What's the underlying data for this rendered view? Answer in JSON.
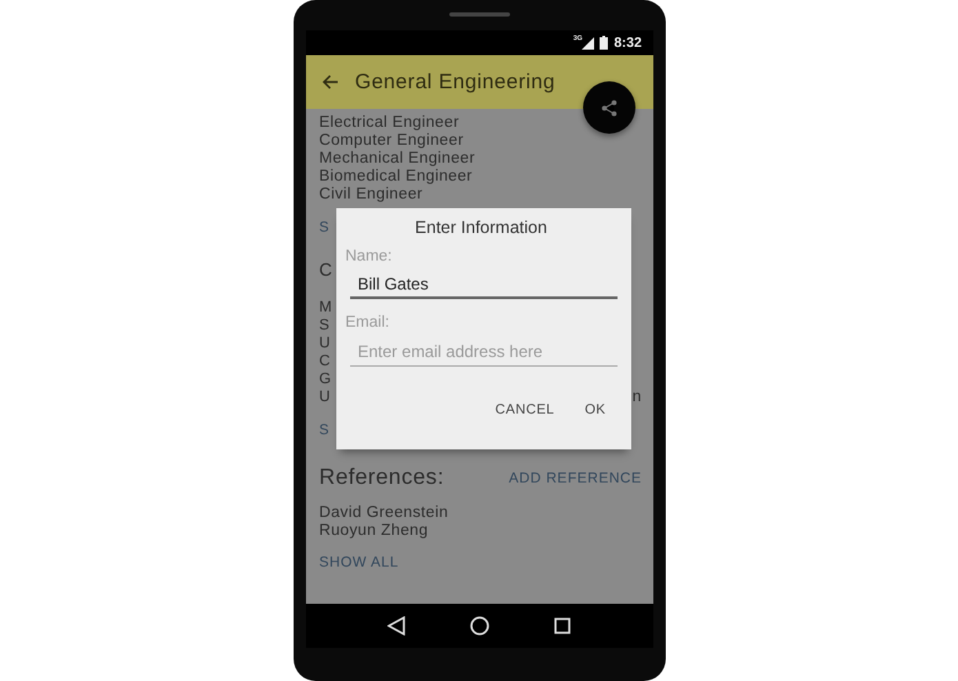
{
  "status_bar": {
    "network": "3G",
    "time": "8:32"
  },
  "app_bar": {
    "title": "General Engineering"
  },
  "content": {
    "specialties": [
      "Electrical Engineer",
      "Computer Engineer",
      "Mechanical Engineer",
      "Biomedical Engineer",
      "Civil Engineer"
    ],
    "specialties_link": "S",
    "section_heading": "C",
    "section_items": [
      "M",
      "S",
      "U",
      "C",
      "G",
      "U"
    ],
    "section_item_tail": "n",
    "section_link": "S",
    "references": {
      "heading": "References:",
      "action": "ADD REFERENCE",
      "items": [
        "David Greenstein",
        "Ruoyun Zheng"
      ],
      "link": "SHOW ALL"
    }
  },
  "dialog": {
    "title": "Enter Information",
    "fields": [
      {
        "label": "Name:",
        "value": "Bill Gates",
        "focused": true
      },
      {
        "label": "Email:",
        "placeholder": "Enter email address here",
        "focused": false
      }
    ],
    "buttons": [
      "CANCEL",
      "OK"
    ]
  }
}
